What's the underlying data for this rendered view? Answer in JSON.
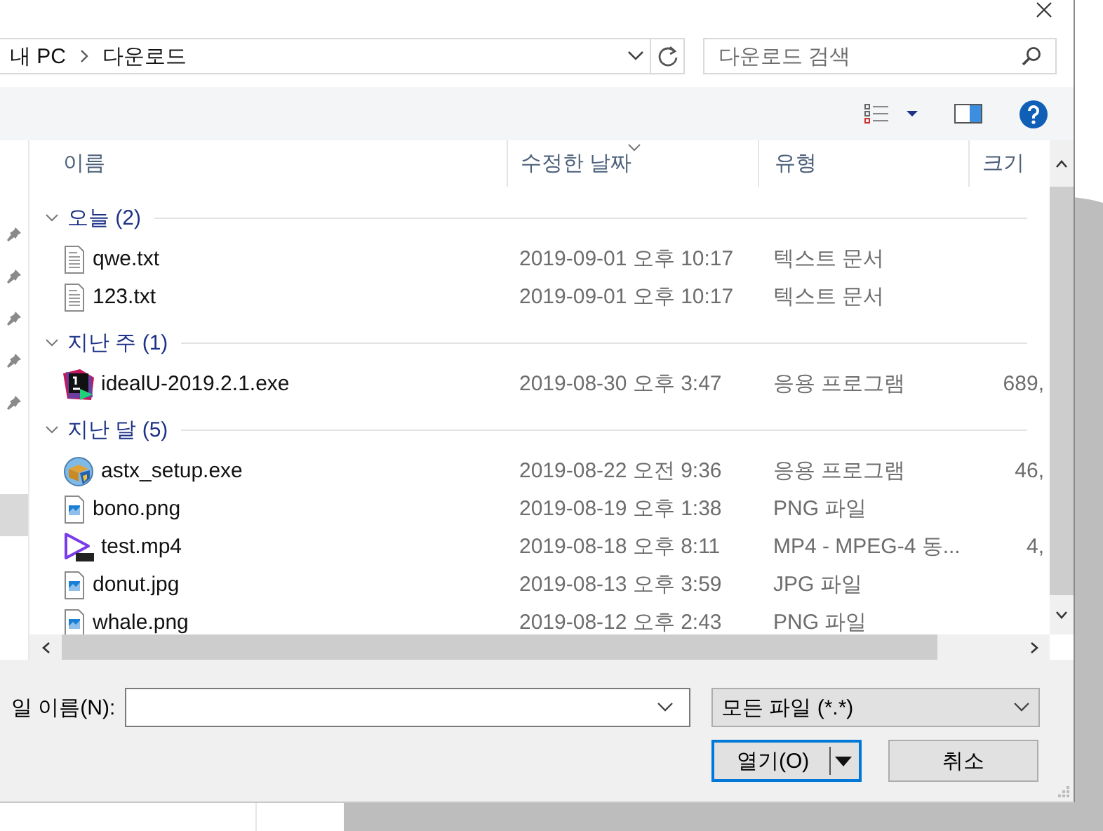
{
  "address": {
    "path": [
      "내 PC",
      "다운로드"
    ]
  },
  "search": {
    "placeholder": "다운로드 검색"
  },
  "nav_items": [
    {
      "pinned": true,
      "selected": false
    },
    {
      "pinned": true,
      "selected": false
    },
    {
      "pinned": true,
      "selected": false
    },
    {
      "pinned": true,
      "selected": false
    },
    {
      "pinned": true,
      "selected": false
    },
    {
      "pinned": false,
      "selected": true
    }
  ],
  "columns": [
    {
      "label": "이름",
      "sorted": false
    },
    {
      "label": "수정한 날짜",
      "sorted": true
    },
    {
      "label": "유형",
      "sorted": false
    },
    {
      "label": "크기",
      "sorted": false
    }
  ],
  "groups": [
    {
      "label": "오늘 (2)",
      "expanded": true,
      "files": [
        {
          "kind": "text",
          "name": "qwe.txt",
          "modified": "2019-09-01 오후 10:17",
          "type": "텍스트 문서"
        },
        {
          "kind": "text",
          "name": "123.txt",
          "modified": "2019-09-01 오후 10:17",
          "type": "텍스트 문서"
        }
      ]
    },
    {
      "label": "지난 주 (1)",
      "expanded": true,
      "files": [
        {
          "kind": "ide",
          "name": "idealU-2019.2.1.exe",
          "modified": "2019-08-30 오후 3:47",
          "type": "응용 프로그램",
          "size": "689,"
        }
      ]
    },
    {
      "label": "지난 달 (5)",
      "expanded": true,
      "files": [
        {
          "kind": "installer",
          "name": "astx_setup.exe",
          "modified": "2019-08-22 오전 9:36",
          "type": "응용 프로그램",
          "size": "46,"
        },
        {
          "kind": "image",
          "name": "bono.png",
          "modified": "2019-08-19 오후 1:38",
          "type": "PNG 파일"
        },
        {
          "kind": "video",
          "name": "test.mp4",
          "modified": "2019-08-18 오후 8:11",
          "type": "MP4 - MPEG-4 동...",
          "size": "4,"
        },
        {
          "kind": "image",
          "name": "donut.jpg",
          "modified": "2019-08-13 오후 3:59",
          "type": "JPG 파일"
        },
        {
          "kind": "image",
          "name": "whale.png",
          "modified": "2019-08-12 오후 2:43",
          "type": "PNG 파일"
        }
      ]
    }
  ],
  "file_name": {
    "label": "일 이름(N):"
  },
  "filter": {
    "value": "모든 파일 (*.*)"
  },
  "buttons": [
    {
      "label": "열기(O)",
      "kind": "split",
      "default": true
    },
    {
      "label": "취소",
      "kind": "plain",
      "default": false
    }
  ]
}
